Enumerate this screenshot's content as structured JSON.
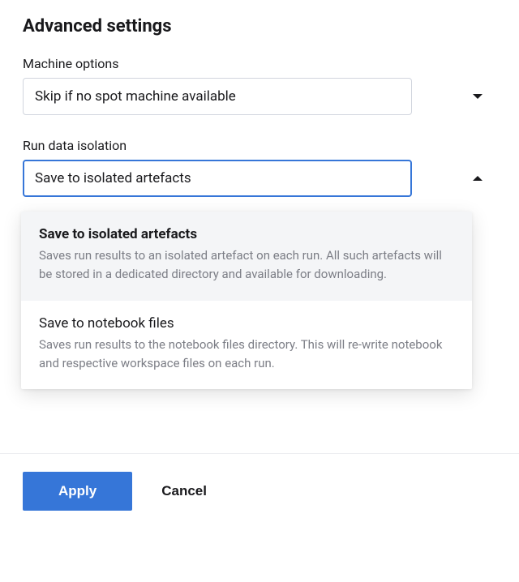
{
  "title": "Advanced settings",
  "machine_options": {
    "label": "Machine options",
    "value": "Skip if no spot machine available"
  },
  "run_data_isolation": {
    "label": "Run data isolation",
    "value": "Save to isolated artefacts",
    "options": [
      {
        "title": "Save to isolated artefacts",
        "description": "Saves run results to an isolated artefact on each run. All such artefacts will be stored in a dedicated directory and available for downloading."
      },
      {
        "title": "Save to notebook files",
        "description": "Saves run results to the notebook files directory. This will re-write notebook and respective workspace files on each run."
      }
    ]
  },
  "footer": {
    "apply": "Apply",
    "cancel": "Cancel"
  }
}
